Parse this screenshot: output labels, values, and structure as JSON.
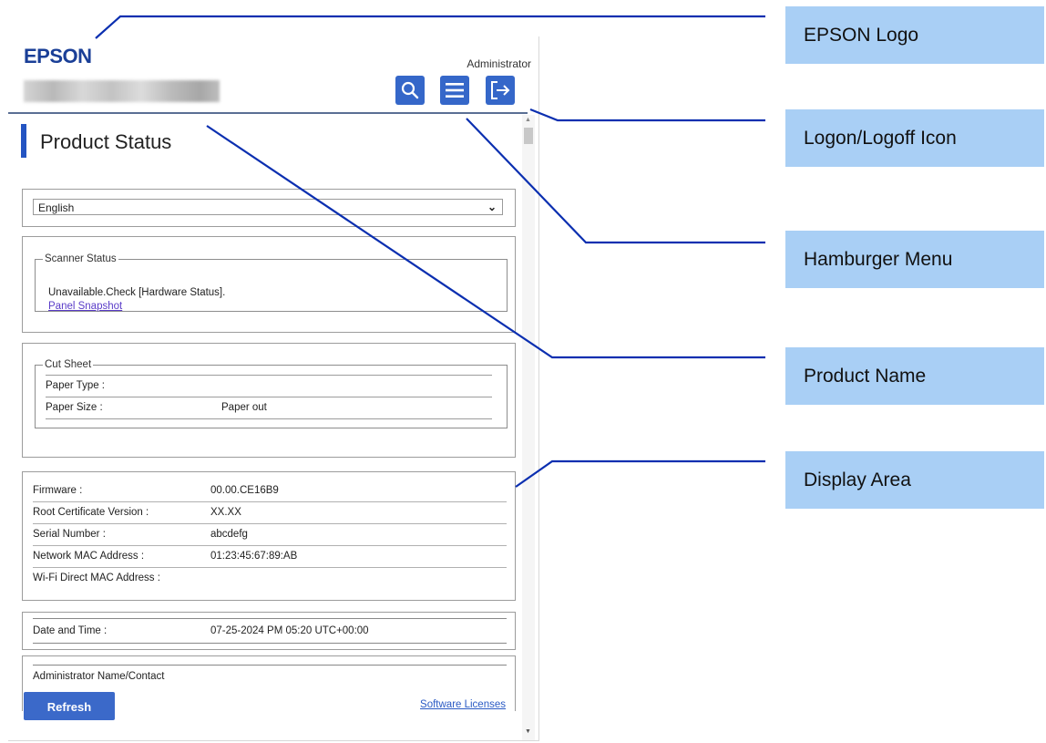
{
  "header": {
    "logo": "EPSON",
    "user_label": "Administrator",
    "icons": [
      "search-icon",
      "hamburger-menu-icon",
      "logoff-icon"
    ]
  },
  "page_title": "Product Status",
  "language": {
    "selected": "English"
  },
  "scanner_status": {
    "legend": "Scanner Status",
    "message": "Unavailable.Check [Hardware Status].",
    "link": "Panel Snapshot"
  },
  "cut_sheet": {
    "legend": "Cut Sheet",
    "rows": [
      {
        "label": "Paper Type :",
        "value": ""
      },
      {
        "label": "Paper Size :",
        "value": "Paper out"
      }
    ]
  },
  "info": {
    "rows": [
      {
        "label": "Firmware :",
        "value": "00.00.CE16B9"
      },
      {
        "label": "Root Certificate Version :",
        "value": "XX.XX"
      },
      {
        "label": "Serial Number :",
        "value": "abcdefg"
      },
      {
        "label": "Network MAC Address :",
        "value": "01:23:45:67:89:AB"
      },
      {
        "label": "Wi-Fi Direct MAC Address :",
        "value": ""
      }
    ]
  },
  "date_time": {
    "label": "Date and Time :",
    "value": "07-25-2024 PM 05:20 UTC+00:00"
  },
  "admin_contact": {
    "label": "Administrator Name/Contact"
  },
  "footer": {
    "refresh": "Refresh",
    "licenses": "Software Licenses"
  },
  "callouts": [
    "EPSON Logo",
    "Logon/Logoff Icon",
    "Hamburger Menu",
    "Product Name",
    "Display Area"
  ],
  "colors": {
    "brand_blue": "#1a3f97",
    "button_blue": "#3567c9",
    "callout_bg": "#a9cff5",
    "line_blue": "#0b2fb0"
  }
}
